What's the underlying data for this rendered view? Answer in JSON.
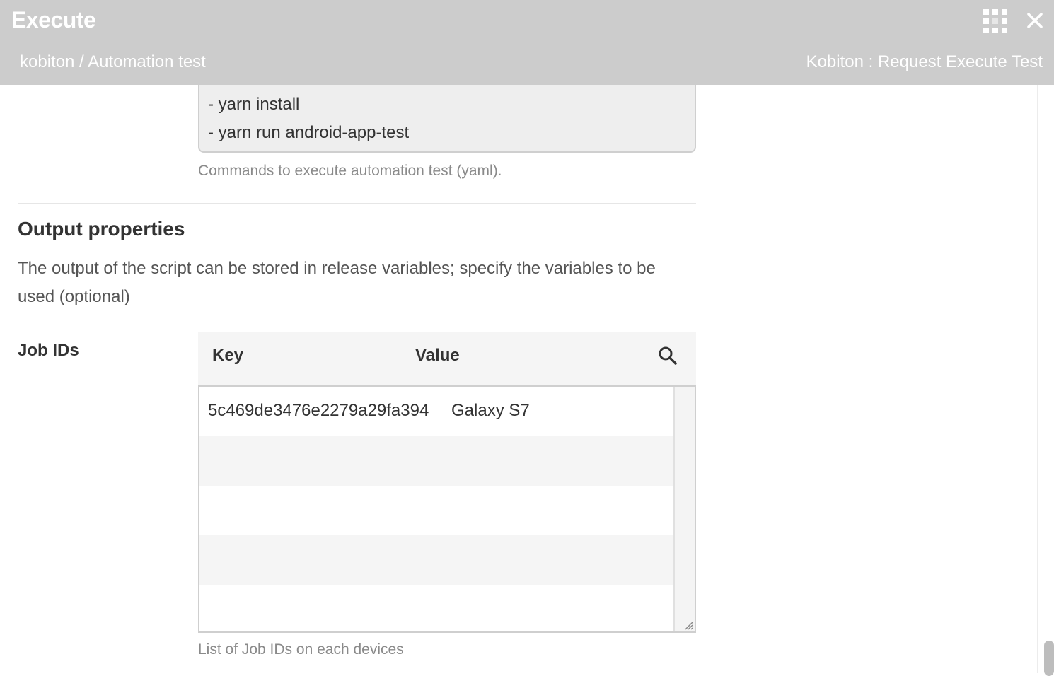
{
  "header": {
    "title": "Execute",
    "breadcrumb": "kobiton / Automation test",
    "task_type": "Kobiton : Request Execute Test",
    "icons": [
      "grid-icon",
      "close-icon"
    ]
  },
  "script": {
    "lines": [
      "- yarn install",
      "- yarn run android-app-test"
    ],
    "help": "Commands to execute automation test (yaml)."
  },
  "output": {
    "title": "Output properties",
    "description": "The output of the script can be stored in release variables; specify the variables to be used (optional)"
  },
  "job_ids": {
    "label": "Job IDs",
    "columns": {
      "key": "Key",
      "value": "Value"
    },
    "rows": [
      {
        "key": "5c469de3476e2279a29fa394",
        "value": "Galaxy S7"
      }
    ],
    "help": "List of Job IDs on each devices"
  }
}
